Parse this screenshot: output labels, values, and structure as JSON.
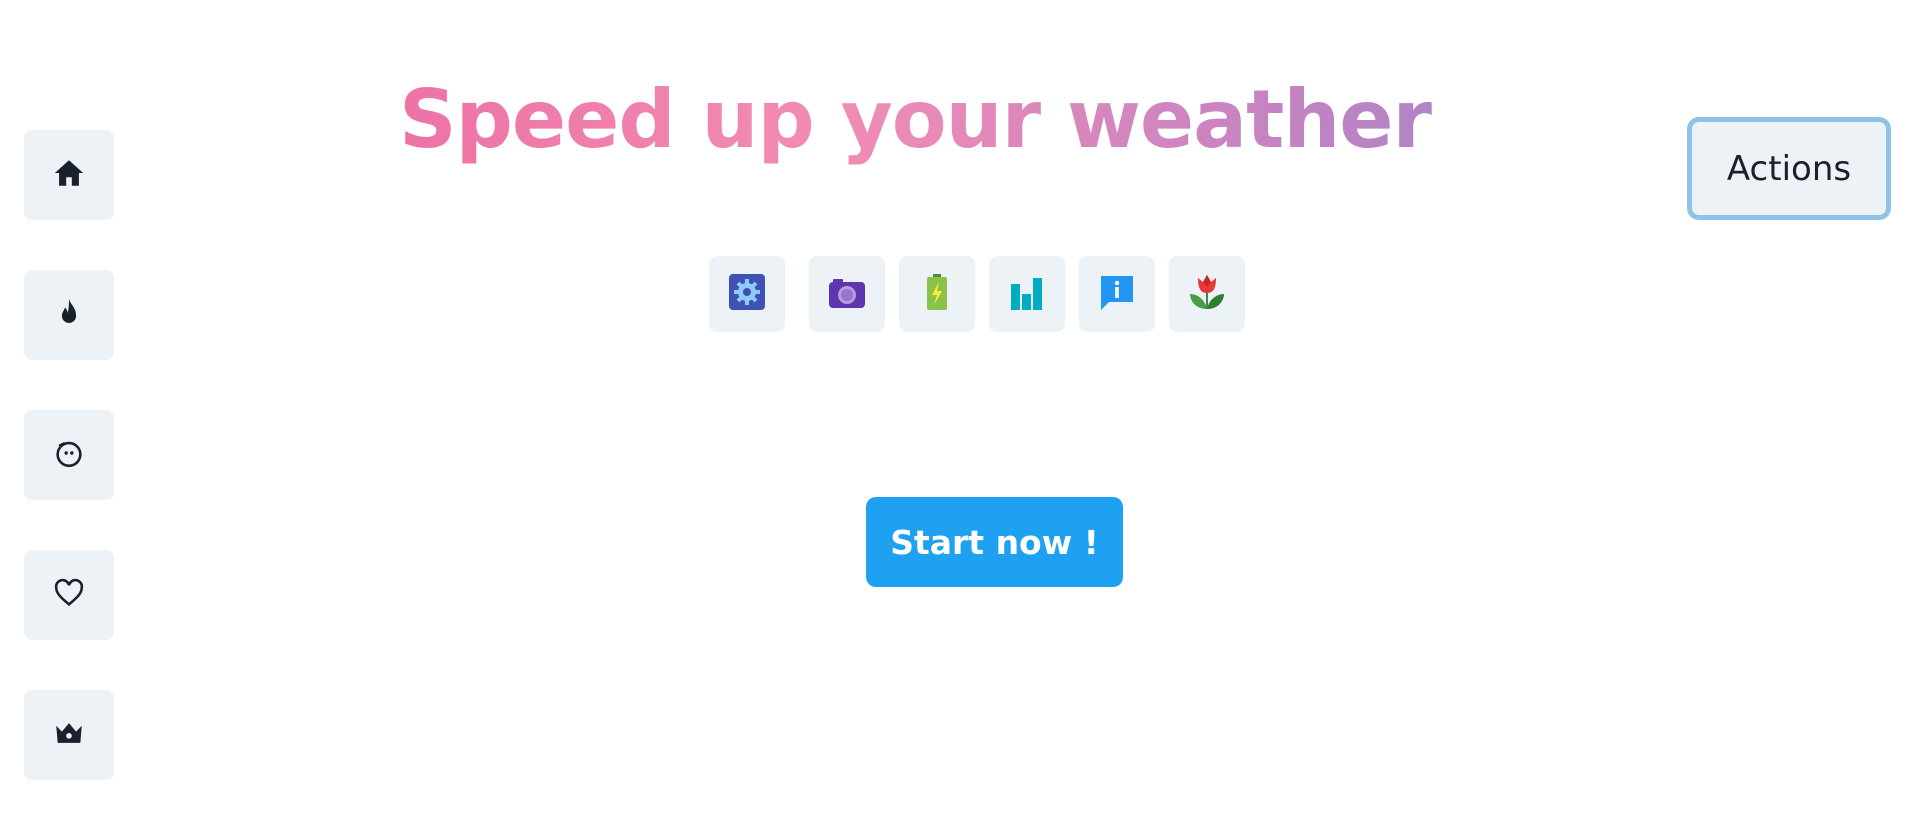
{
  "headline": "Speed up your weather",
  "sidebar": {
    "items": [
      {
        "icon": "home-icon"
      },
      {
        "icon": "fire-icon"
      },
      {
        "icon": "face-icon"
      },
      {
        "icon": "heart-icon"
      },
      {
        "icon": "crown-icon"
      }
    ]
  },
  "tiles": [
    {
      "icon": "settings-icon"
    },
    {
      "icon": "camera-icon"
    },
    {
      "icon": "battery-icon"
    },
    {
      "icon": "bar-chart-icon"
    },
    {
      "icon": "info-chat-icon"
    },
    {
      "icon": "tulip-icon"
    }
  ],
  "cta": {
    "label": "Start now !"
  },
  "actions": {
    "label": "Actions"
  },
  "colors": {
    "tile_bg": "#edf2f7",
    "cta_bg": "#1fa1f2",
    "actions_border": "#90c2e8",
    "gradient_start": "#e85b98",
    "gradient_end": "#7d87c9"
  }
}
